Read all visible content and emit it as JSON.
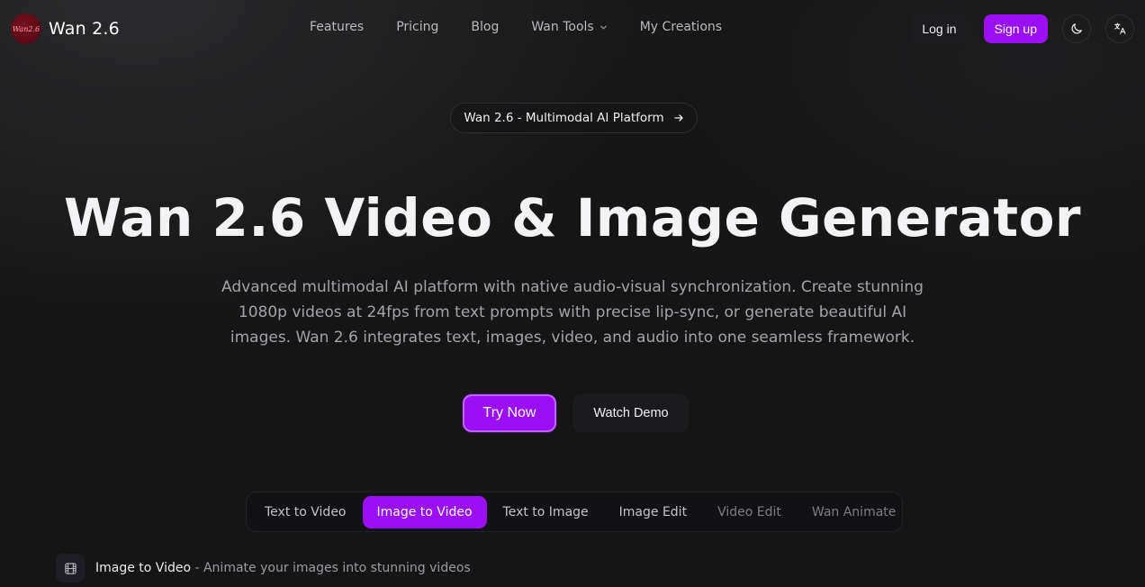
{
  "header": {
    "logo_badge": "Wan2.6",
    "logo_text": "Wan 2.6",
    "nav": [
      {
        "label": "Features"
      },
      {
        "label": "Pricing"
      },
      {
        "label": "Blog"
      },
      {
        "label": "Wan Tools",
        "has_dropdown": true
      },
      {
        "label": "My Creations"
      }
    ],
    "login_label": "Log in",
    "signup_label": "Sign up",
    "theme_icon": "moon-icon",
    "language_icon": "translate-icon"
  },
  "announcement": {
    "label": "Wan 2.6 - Multimodal AI Platform",
    "icon": "arrow-right-icon"
  },
  "hero": {
    "title": "Wan 2.6 Video & Image Generator",
    "subtitle": "Advanced multimodal AI platform with native audio-visual synchronization. Create stunning 1080p videos at 24fps from text prompts with precise lip-sync, or generate beautiful AI images. Wan 2.6 integrates text, images, video, and audio into one seamless framework.",
    "primary_cta": "Try Now",
    "secondary_cta": "Watch Demo"
  },
  "tabs": [
    {
      "label": "Text to Video",
      "active": false
    },
    {
      "label": "Image to Video",
      "active": true
    },
    {
      "label": "Text to Image",
      "active": false
    },
    {
      "label": "Image Edit",
      "active": false
    },
    {
      "label": "Video Edit",
      "active": false,
      "dimmed": true
    },
    {
      "label": "Wan Animate",
      "active": false,
      "dimmed": true
    }
  ],
  "section": {
    "icon": "film-icon",
    "title": "Image to Video",
    "description": " - Animate your images into stunning videos"
  },
  "colors": {
    "accent": "#9b0ff5",
    "background": "#151515",
    "muted_text": "#a3a3ab"
  }
}
